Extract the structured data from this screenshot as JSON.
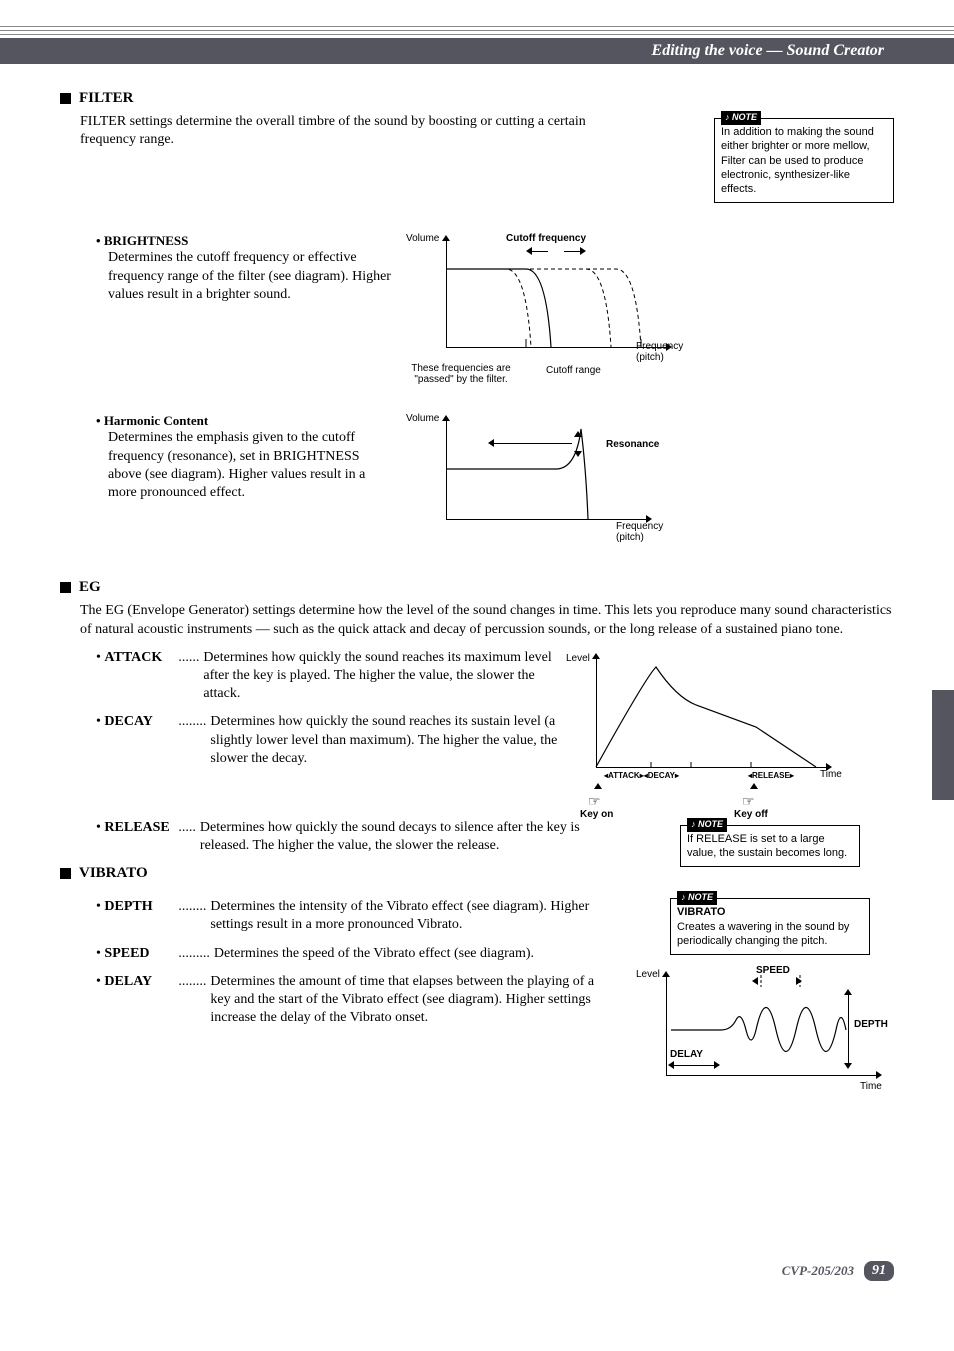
{
  "header": {
    "title": "Editing the voice  —  Sound Creator"
  },
  "filter": {
    "heading": "FILTER",
    "intro": "FILTER settings determine the overall timbre of the sound by boosting or cutting a certain frequency range.",
    "note": "In addition to making the sound either brighter or more mellow, Filter can be used to produce electronic, synthesizer-like effects.",
    "brightness": {
      "label": "BRIGHTNESS",
      "text": "Determines the cutoff frequency or effective frequency range of the filter (see diagram). Higher values result in a brighter sound."
    },
    "harmonic": {
      "label": "Harmonic Content",
      "text": "Determines the emphasis given to the cutoff frequency (resonance), set in BRIGHTNESS above (see diagram). Higher values result in a more pronounced effect."
    },
    "diagram1": {
      "yaxis": "Volume",
      "cutoff": "Cutoff frequency",
      "passed": "These frequencies are \"passed\" by the filter.",
      "cutoff_range": "Cutoff range",
      "freq": "Frequency (pitch)"
    },
    "diagram2": {
      "yaxis": "Volume",
      "resonance": "Resonance",
      "freq": "Frequency (pitch)"
    }
  },
  "eg": {
    "heading": "EG",
    "intro": "The EG (Envelope Generator) settings determine how the level of the sound changes in time. This lets you reproduce many sound characteristics of natural acoustic instruments — such as the quick attack and decay of percussion sounds, or the long release of a sustained piano tone.",
    "attack": {
      "label": "ATTACK",
      "dots": "......",
      "text": "Determines how quickly the sound reaches its maximum level after the key is played. The higher the value, the slower the attack."
    },
    "decay": {
      "label": "DECAY",
      "dots": "........",
      "text": "Determines how quickly the sound reaches its sustain level (a slightly lower level than maximum). The higher the value, the slower the decay."
    },
    "release": {
      "label": "RELEASE",
      "dots": ".....",
      "text": "Determines how quickly the sound decays to silence after the key is released. The higher the value, the slower the release."
    },
    "diagram": {
      "yaxis": "Level",
      "attack": "ATTACK",
      "decay": "DECAY",
      "release": "RELEASE",
      "time": "Time",
      "keyon": "Key on",
      "keyoff": "Key off"
    },
    "note": "If RELEASE is set to a large value, the sustain becomes long."
  },
  "vibrato": {
    "heading": "VIBRATO",
    "depth": {
      "label": "DEPTH",
      "dots": "........",
      "text": "Determines the intensity of the Vibrato effect (see diagram). Higher settings result in a more pronounced Vibrato."
    },
    "speed": {
      "label": "SPEED",
      "dots": ".........",
      "text": "Determines the speed of the Vibrato effect (see diagram)."
    },
    "delay": {
      "label": "DELAY",
      "dots": "........",
      "text": "Determines the amount of time that elapses between the playing of a key and the start of the Vibrato effect (see diagram). Higher settings increase the delay of the Vibrato onset."
    },
    "note_title": "VIBRATO",
    "note": "Creates a wavering in the sound by periodically changing the pitch.",
    "diagram": {
      "yaxis": "Level",
      "speed": "SPEED",
      "depth": "DEPTH",
      "delay": "DELAY",
      "time": "Time"
    }
  },
  "footer": {
    "model": "CVP-205/203",
    "page": "91"
  }
}
